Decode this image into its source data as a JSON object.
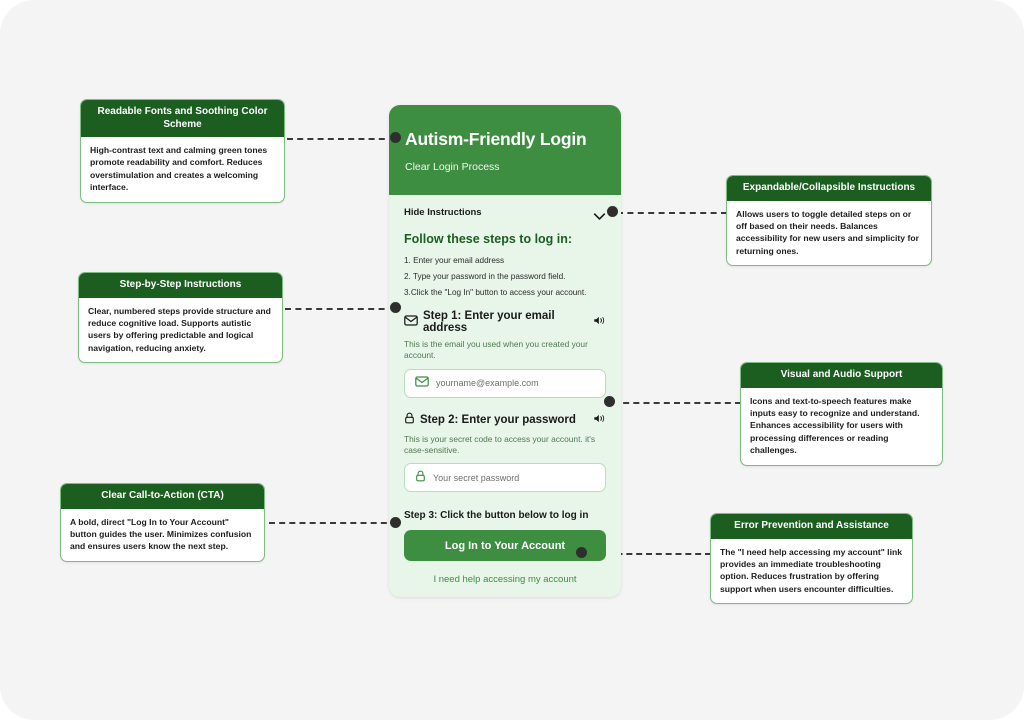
{
  "card": {
    "title": "Autism-Friendly Login",
    "subtitle": "Clear Login Process",
    "toggle_label": "Hide Instructions",
    "steps_heading": "Follow these steps to log in:",
    "steps": [
      "1. Enter your email address",
      "2. Type your password in the password field.",
      "3.Click the \"Log In\" button to access your account."
    ],
    "step1": {
      "title": "Step 1: Enter your email address",
      "description": "This is the email you used when you created your account.",
      "placeholder": "yourname@example.com"
    },
    "step2": {
      "title": "Step 2: Enter your password",
      "description": "This is your secret code to access your account. it's case-sensitive.",
      "placeholder": "Your secret password"
    },
    "step3_label": "Step 3: Click the button below to log in",
    "login_button": "Log In to Your Account",
    "help_link": "I need help accessing my account"
  },
  "callouts": {
    "fonts": {
      "title": "Readable Fonts and Soothing Color Scheme",
      "body": "High-contrast text and calming green tones promote readability and comfort. Reduces overstimulation and creates a welcoming interface."
    },
    "steps": {
      "title": "Step-by-Step Instructions",
      "body": "Clear, numbered steps provide structure and reduce cognitive load. Supports autistic users by offering predictable and logical navigation, reducing anxiety."
    },
    "cta": {
      "title": "Clear Call-to-Action (CTA)",
      "body": "A bold, direct \"Log In to Your Account\" button guides the user. Minimizes confusion and ensures users know the next step."
    },
    "expandable": {
      "title": "Expandable/Collapsible Instructions",
      "body": "Allows users to toggle detailed steps on or off based on their needs. Balances accessibility for new users and simplicity for returning ones."
    },
    "audio": {
      "title": "Visual and Audio Support",
      "body": "Icons and text-to-speech features make inputs easy to recognize and understand. Enhances accessibility for users with processing differences or reading challenges."
    },
    "error": {
      "title": "Error Prevention and Assistance",
      "body": "The \"I need help accessing my account\" link provides an immediate troubleshooting option. Reduces frustration by offering support when users encounter difficulties."
    }
  },
  "colors": {
    "header_green": "#3e8e41",
    "callout_green": "#1b5e20",
    "body_green": "#e8f5e9",
    "canvas": "#f4f4f4"
  }
}
